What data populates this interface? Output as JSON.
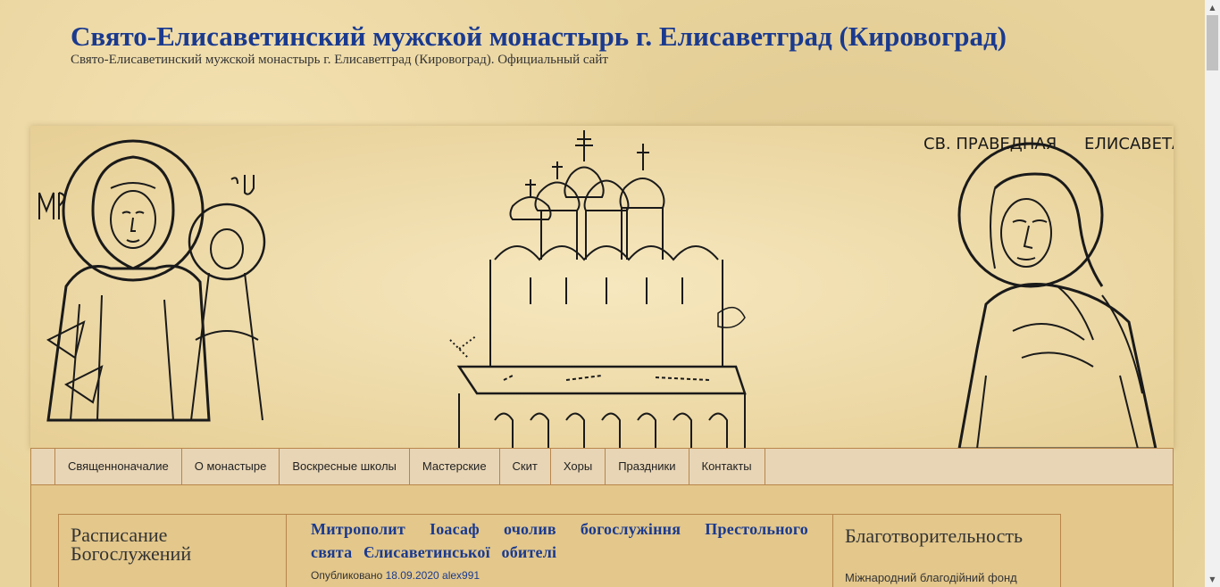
{
  "site": {
    "title": "Свято-Елисаветинский мужской монастырь г. Елисаветград (Кировоград)",
    "description": "Свято-Елисаветинский мужской монастырь г. Елисаветград (Кировоград). Официальный сайт"
  },
  "banner": {
    "icon_left_text": "МР",
    "icon_left_text2": "ӨУ",
    "icon_right_text": "СВ. ПРАВЕДНАЯ",
    "icon_right_text2": "ЕЛИСАВЕТА"
  },
  "menu": {
    "items": [
      {
        "label": "Священноначалие"
      },
      {
        "label": "О монастыре"
      },
      {
        "label": "Воскресные школы"
      },
      {
        "label": "Мастерские"
      },
      {
        "label": "Скит"
      },
      {
        "label": "Хоры"
      },
      {
        "label": "Праздники"
      },
      {
        "label": "Контакты"
      }
    ]
  },
  "left_sidebar": {
    "heading": "Расписание Богослужений"
  },
  "post": {
    "title": "Митрополит Іоасаф очолив богослужіння Престольного свята Єлисаветинської обителі",
    "meta_prefix": "Опубликовано",
    "date": "18.09.2020",
    "author": "alex991"
  },
  "right_sidebar": {
    "heading": "Благотворительность",
    "text": "Міжнародний благодійний фонд"
  },
  "colors": {
    "accent": "#1a3a8f",
    "border": "#b8854a",
    "menu_bg": "#e8d5b5",
    "background": "#e8d39c"
  },
  "scrollbar": {
    "up_icon": "triangle-up",
    "down_icon": "triangle-down"
  }
}
